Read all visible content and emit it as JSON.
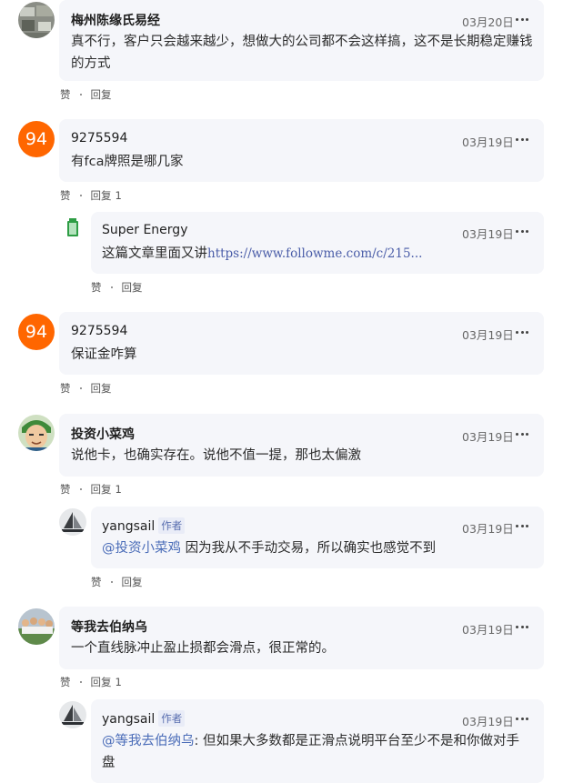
{
  "comments": [
    {
      "author": "梅州陈缘氏易经",
      "date": "03月20日",
      "text": "真不行，客户只会越来越少，想做大的公司都不会这样搞，这不是长期稳定赚钱的方式",
      "like_label": "赞",
      "reply_label": "回复",
      "avatar_icon": "photo-avatar"
    },
    {
      "author": "9275594",
      "avatar_text": "94",
      "date": "03月19日",
      "text": "有fca牌照是哪几家",
      "like_label": "赞",
      "reply_label": "回复",
      "reply_count": "1",
      "replies": [
        {
          "author": "Super Energy",
          "date": "03月19日",
          "text_prefix": "这篇文章里面又讲",
          "link": "https://www.followme.com/c/215...",
          "like_label": "赞",
          "reply_label": "回复",
          "avatar_icon": "battery-avatar"
        }
      ]
    },
    {
      "author": "9275594",
      "avatar_text": "94",
      "date": "03月19日",
      "text": "保证金咋算",
      "like_label": "赞",
      "reply_label": "回复"
    },
    {
      "author": "投资小菜鸡",
      "date": "03月19日",
      "text": "说他卡，也确实存在。说他不值一提，那也太偏激",
      "like_label": "赞",
      "reply_label": "回复",
      "reply_count": "1",
      "avatar_icon": "anime-avatar",
      "replies": [
        {
          "author": "yangsail",
          "badge": "作者",
          "date": "03月19日",
          "mention": "@投资小菜鸡",
          "text": " 因为我从不手动交易，所以确实也感觉不到",
          "like_label": "赞",
          "reply_label": "回复",
          "avatar_icon": "sailboat-avatar"
        }
      ]
    },
    {
      "author": "等我去伯纳乌",
      "date": "03月19日",
      "text": "一个直线脉冲止盈止损都会滑点，很正常的。",
      "like_label": "赞",
      "reply_label": "回复",
      "reply_count": "1",
      "avatar_icon": "team-photo-avatar",
      "replies": [
        {
          "author": "yangsail",
          "badge": "作者",
          "date": "03月19日",
          "mention": "@等我去伯纳乌",
          "text_line1": ": 但如果大多数都是正滑点说明平台至少不是和你做对手",
          "text_line2": "盘",
          "avatar_icon": "sailboat-avatar"
        }
      ]
    }
  ],
  "colors": {
    "bubble_bg": "#f5f6fa",
    "avatar_orange": "#ff6600",
    "link": "#4a5da8",
    "mention": "#4a6cb8"
  }
}
